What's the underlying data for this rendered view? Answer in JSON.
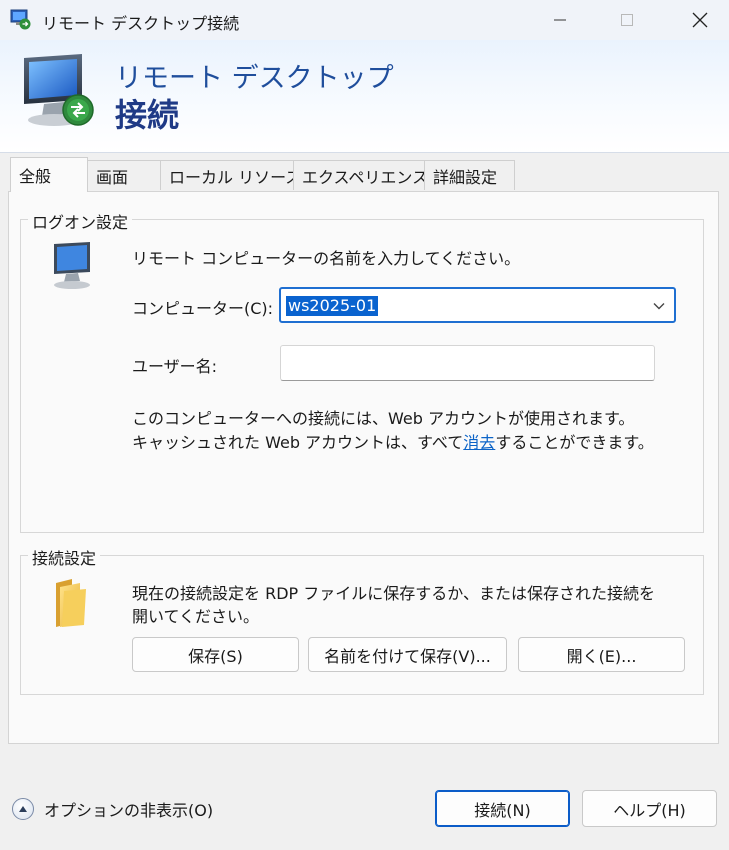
{
  "window": {
    "title": "リモート デスクトップ接続"
  },
  "banner": {
    "line1": "リモート デスクトップ",
    "line2": "接続"
  },
  "tabs": [
    {
      "label": "全般",
      "active": true
    },
    {
      "label": "画面",
      "active": false
    },
    {
      "label": "ローカル リソース",
      "active": false
    },
    {
      "label": "エクスペリエンス",
      "active": false
    },
    {
      "label": "詳細設定",
      "active": false
    }
  ],
  "logon": {
    "group_label": "ログオン設定",
    "instruction": "リモート コンピューターの名前を入力してください。",
    "computer_label": "コンピューター(C):",
    "computer_value": "ws2025-01",
    "username_label": "ユーザー名:",
    "username_value": "",
    "info_line1": "このコンピューターへの接続には、Web アカウントが使用されます。",
    "info_line2_before": "キャッシュされた Web アカウントは、すべて",
    "info_link": "消去",
    "info_line2_after": "することができます。"
  },
  "connection": {
    "group_label": "接続設定",
    "description_line1": "現在の接続設定を RDP ファイルに保存するか、または保存された接続を",
    "description_line2": "開いてください。",
    "save_label": "保存(S)",
    "save_as_label": "名前を付けて保存(V)...",
    "open_label": "開く(E)..."
  },
  "footer": {
    "options_label": "オプションの非表示(O)",
    "connect_label": "接続(N)",
    "help_label": "ヘルプ(H)"
  },
  "colors": {
    "accent": "#0b63c7",
    "banner_text": "#1f4e9c",
    "selection": "#0a63cf"
  }
}
